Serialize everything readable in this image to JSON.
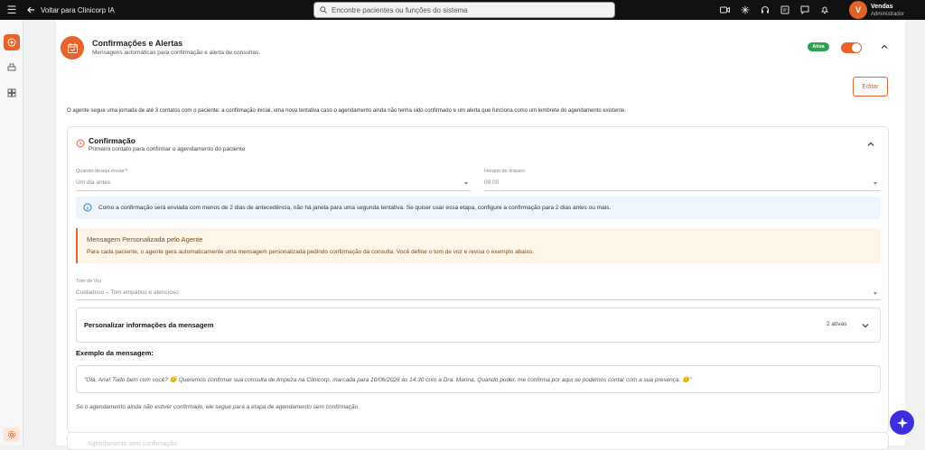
{
  "topbar": {
    "back_label": "Voltar para Clinicorp IA",
    "search_placeholder": "Encontre pacientes ou funções do sistema",
    "icons": [
      "video-icon",
      "sparkle-icon",
      "headset-icon",
      "notes-icon",
      "chat-icon",
      "bell-icon"
    ],
    "user": {
      "initial": "V",
      "name": "Vendas",
      "role": "Administrador",
      "avatar_color": "#e0642a"
    }
  },
  "sidebar": {
    "items": [
      "add-icon",
      "printer-icon",
      "dashboard-icon",
      "settings-icon"
    ],
    "accent": "#e8622b"
  },
  "section": {
    "title": "Confirmações e Alertas",
    "subtitle": "Mensagens automáticas para confirmação e alerta de consultas.",
    "status_badge": "Ativa",
    "toggle_on": true,
    "edit_label": "Editar",
    "intro": "O agente segue uma jornada de até 3 contatos com o paciente: a confirmação inicial, uma nova tentativa caso o agendamento ainda não tenha sido confirmado e um alerta que funciona como um lembrete do agendamento existente."
  },
  "confirmation": {
    "title": "Confirmação",
    "subtitle": "Primeiro contato para confirmar o agendamento do paciente",
    "when_label": "Quando deseja enviar?",
    "when_value": "Um dia antes",
    "time_label": "Horário de disparo",
    "time_value": "09:00",
    "info_text": "Como a confirmação será enviada com menos de 2 dias de antecedência, não há janela para uma segunda tentativa. Se quiser usar essa etapa, configure a confirmação para 2 dias antes ou mais.",
    "notice_title": "Mensagem Personalizada pelo Agente",
    "notice_text": "Para cada paciente, o agente gera automaticamente uma mensagem personalizada pedindo confirmação da consulta. Você define o tom de voz e revisa o exemplo abaixo.",
    "tone_label": "Tom de Voz",
    "tone_value": "Cuidadoso – Tom empático e atencioso",
    "personalize_title": "Personalizar informações da mensagem",
    "personalize_count": "2 ativas",
    "example_title": "Exemplo da mensagem:",
    "example_text": "\"Olá, Ana! Tudo bem com você? 😊 Queremos confirmar sua consulta de limpeza na Clinicorp, marcada para 10/06/2026 às 14:30 com a Dra. Marina. Quando puder, me confirma por aqui se podemos contar com a sua presença. 😊\"",
    "footer_text": "Se o agendamento ainda não estiver confirmado, ele segue para a etapa de agendamento sem confirmação."
  },
  "next_card": {
    "title": "Agendamento sem confirmação"
  }
}
